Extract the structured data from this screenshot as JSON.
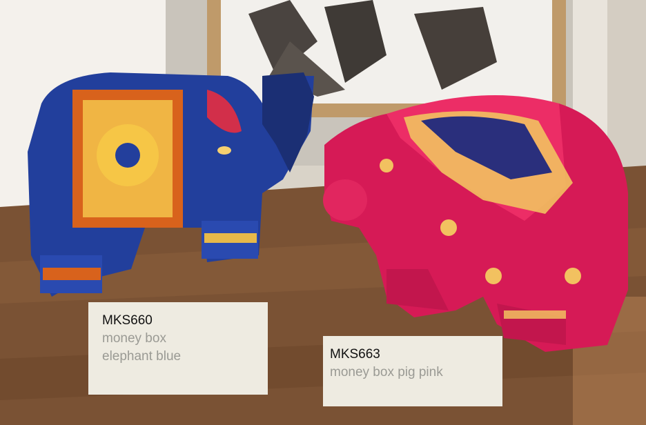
{
  "colors": {
    "top_bar": "#e6b24c",
    "label_bg": "#eeebe1",
    "code_text": "#111111",
    "desc_text": "#9a9a94",
    "elephant_blue": "#1f3d9a",
    "pig_pink": "#d81d5a"
  },
  "products": [
    {
      "code": "MKS660",
      "desc_line1": "money box",
      "desc_line2": "elephant blue"
    },
    {
      "code": "MKS663",
      "desc_line1": "money box pig pink"
    }
  ]
}
